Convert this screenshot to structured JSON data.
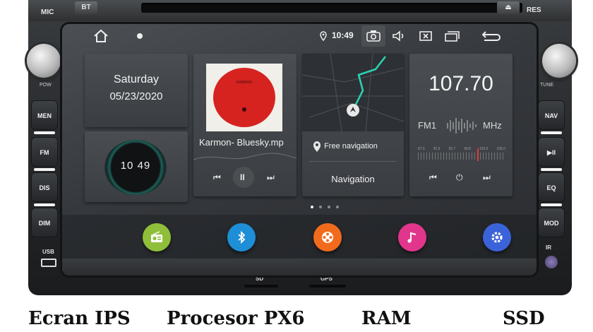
{
  "unit": {
    "mic_label": "MIC",
    "bt_button": "BT",
    "eject_icon": "eject-icon",
    "res_label": "RES",
    "pow_label": "POW",
    "tune_label": "TUNE",
    "left_buttons": [
      "MEN",
      "FM",
      "DIS",
      "DIM"
    ],
    "right_buttons": [
      "NAV",
      "▶II",
      "EQ",
      "MOD"
    ],
    "usb_label": "USB",
    "ir_label": "IR",
    "sd_label": "SD",
    "gps_label": "GPS"
  },
  "status_bar": {
    "home_icon": "home-icon",
    "shield_icon": "shield-icon",
    "location_icon": "location-pin-icon",
    "time": "10:49",
    "icons": [
      "camera-icon",
      "volume-icon",
      "close-box-icon",
      "recent-apps-icon",
      "back-icon"
    ]
  },
  "widgets": {
    "day": "Saturday",
    "date": "05/23/2020",
    "clock": "10 49",
    "music": {
      "album_label": "KARMON",
      "title": "Karmon- Bluesky.mp",
      "prev": "⏮",
      "play": "II",
      "next": "⏭"
    },
    "navigation": {
      "action": "Free navigation",
      "title": "Navigation"
    },
    "radio": {
      "frequency": "107.70",
      "band": "FM1",
      "unit": "MHz",
      "scale": [
        "87.5",
        "91.6",
        "95.7",
        "99.8",
        "103.9",
        "108.0"
      ],
      "prev": "⏮",
      "power": "⏻",
      "next": "⏭"
    }
  },
  "page_indicator": {
    "count": 4,
    "active": 0
  },
  "dock": [
    {
      "name": "radio-app-icon",
      "color": "#8fbf3a"
    },
    {
      "name": "bluetooth-app-icon",
      "color": "#1e8fd6"
    },
    {
      "name": "video-app-icon",
      "color": "#f26b1d"
    },
    {
      "name": "music-app-icon",
      "color": "#e2368d"
    },
    {
      "name": "settings-app-icon",
      "color": "#3b63d9"
    }
  ],
  "caption": [
    "Ecran IPS",
    "Procesor PX6",
    "RAM",
    "SSD"
  ]
}
